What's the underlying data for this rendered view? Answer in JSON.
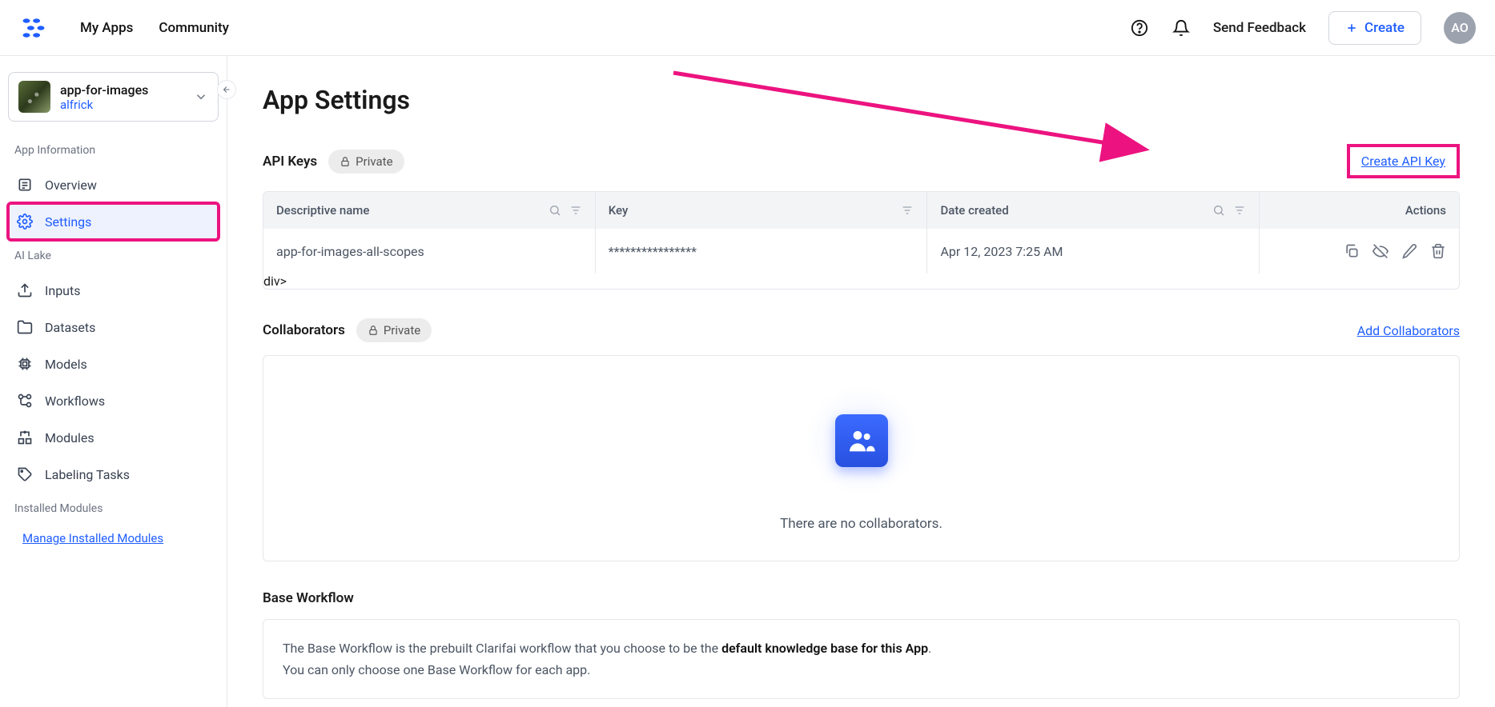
{
  "topbar": {
    "nav": {
      "my_apps": "My Apps",
      "community": "Community"
    },
    "feedback": "Send Feedback",
    "create": "Create",
    "avatar_initials": "AO"
  },
  "sidebar": {
    "app_selector": {
      "name": "app-for-images",
      "user": "alfrick"
    },
    "sections": {
      "app_info": "App Information",
      "ai_lake": "AI Lake",
      "installed": "Installed Modules"
    },
    "items": {
      "overview": "Overview",
      "settings": "Settings",
      "inputs": "Inputs",
      "datasets": "Datasets",
      "models": "Models",
      "workflows": "Workflows",
      "modules": "Modules",
      "labeling": "Labeling Tasks"
    },
    "manage_link": "Manage Installed Modules"
  },
  "main": {
    "title": "App Settings",
    "api_keys": {
      "heading": "API Keys",
      "private": "Private",
      "create_link": "Create API Key",
      "columns": {
        "name": "Descriptive name",
        "key": "Key",
        "date": "Date created",
        "actions": "Actions"
      },
      "rows": [
        {
          "name": "app-for-images-all-scopes",
          "key": "****************",
          "date": "Apr 12, 2023 7:25 AM"
        }
      ]
    },
    "collaborators": {
      "heading": "Collaborators",
      "private": "Private",
      "add_link": "Add Collaborators",
      "empty": "There are no collaborators."
    },
    "base_workflow": {
      "heading": "Base Workflow",
      "line1_a": "The Base Workflow is the prebuilt Clarifai workflow that you choose to be the ",
      "line1_b": "default knowledge base for this App",
      "line1_c": ".",
      "line2": "You can only choose one Base Workflow for each app."
    }
  }
}
